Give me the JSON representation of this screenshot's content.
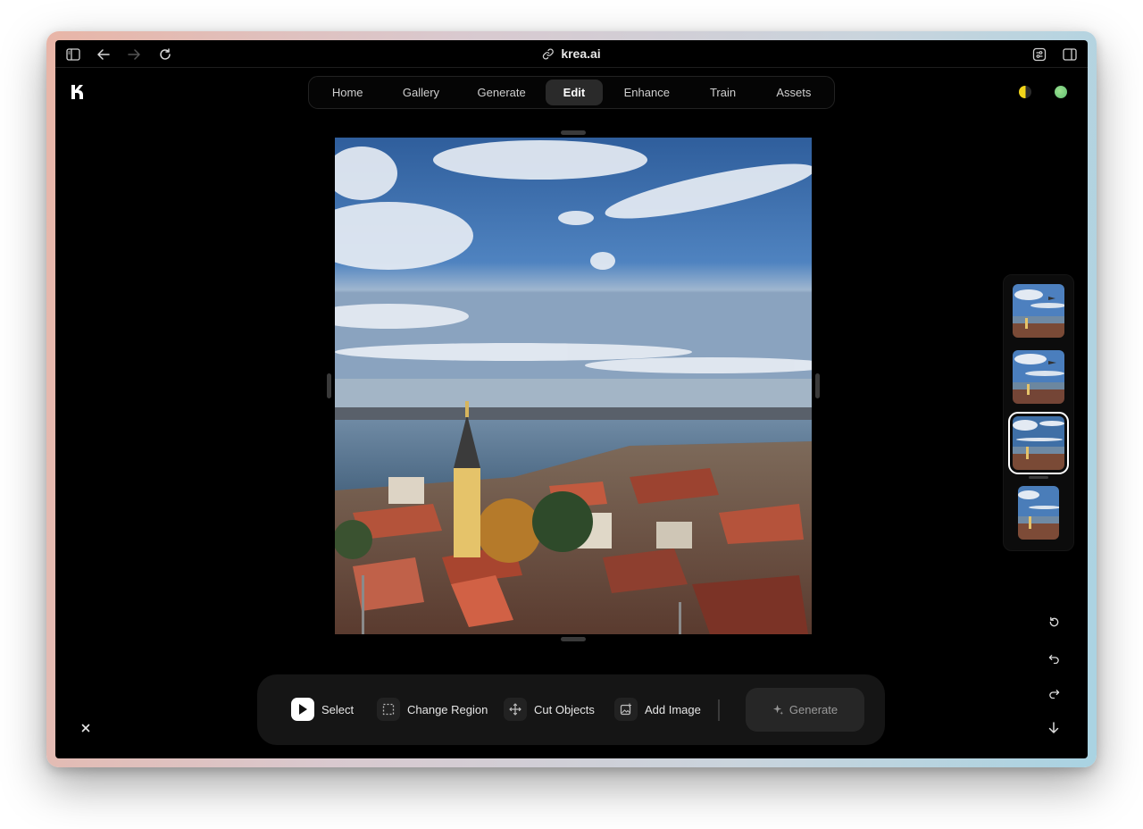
{
  "browser": {
    "url": "krea.ai"
  },
  "nav": {
    "tabs": [
      {
        "label": "Home"
      },
      {
        "label": "Gallery"
      },
      {
        "label": "Generate"
      },
      {
        "label": "Edit"
      },
      {
        "label": "Enhance"
      },
      {
        "label": "Train"
      },
      {
        "label": "Assets"
      }
    ],
    "active_tab": "Edit"
  },
  "colors": {
    "background": "#000000",
    "active_tab": "#2a2a2a",
    "toolbar": "#151515",
    "status_dot_yellow": "#f2d51a",
    "status_dot_green": "#7fd27a"
  },
  "toolbar": {
    "select_label": "Select",
    "change_region_label": "Change Region",
    "cut_objects_label": "Cut Objects",
    "add_image_label": "Add Image",
    "generate_label": "Generate"
  },
  "icons": {
    "sidebar": "sidebar-toggle-icon",
    "back": "arrow-left-icon",
    "forward": "arrow-right-icon",
    "reload": "reload-icon",
    "link": "link-icon",
    "extensions": "extensions-icon",
    "split": "split-view-icon",
    "logo": "krea-logo-icon",
    "select": "cursor-icon",
    "change_region": "dashed-square-icon",
    "cut_objects": "move-icon",
    "add_image": "add-image-icon",
    "generate": "sparkle-icon",
    "reset": "reset-icon",
    "undo": "undo-icon",
    "redo": "redo-icon",
    "download": "download-icon",
    "close": "close-icon"
  },
  "thumbnails": {
    "count": 4,
    "selected_index": 2
  }
}
